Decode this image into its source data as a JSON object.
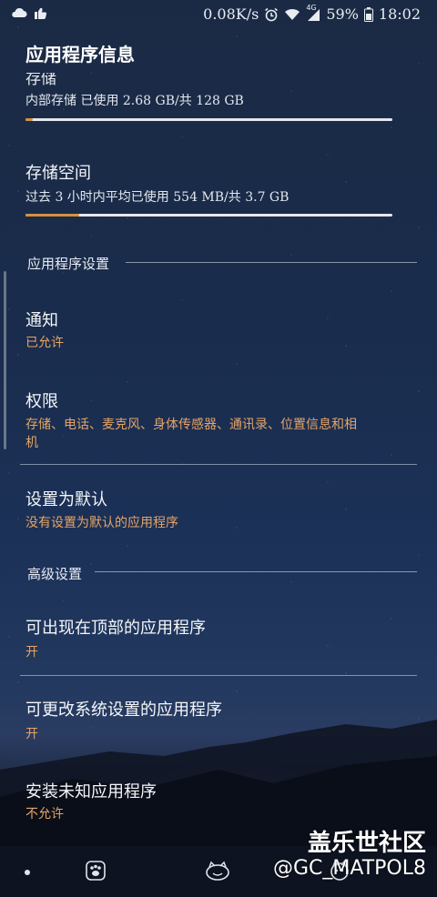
{
  "status_bar": {
    "speed": "0.08K/s",
    "battery_pct": "59%",
    "time": "18:02",
    "network": "4G",
    "icons": [
      "cloud-icon",
      "thumb-up-icon",
      "alarm-icon",
      "wifi-icon",
      "signal-icon",
      "battery-icon"
    ]
  },
  "header": {
    "title": "应用程序信息",
    "cut_off_item": "存储"
  },
  "storage_top": {
    "subtitle": "内部存储 已使用 2.68 GB/共 128 GB",
    "progress": 0.021
  },
  "storage_space": {
    "title": "存储空间",
    "subtitle": "过去 3 小时内平均已使用 554 MB/共 3.7 GB",
    "progress": 0.146
  },
  "sections": {
    "app_settings": "应用程序设置",
    "advanced": "高级设置"
  },
  "items": {
    "notifications": {
      "title": "通知",
      "value": "已允许"
    },
    "permissions": {
      "title": "权限",
      "value_line1": "存储、电话、麦克风、身体传感器、通讯录、位置信息和相",
      "value_line2": "机"
    },
    "default": {
      "title": "设置为默认",
      "value": "没有设置为默认的应用程序"
    },
    "on_top": {
      "title": "可出现在顶部的应用程序",
      "value": "开"
    },
    "system_settings": {
      "title": "可更改系统设置的应用程序",
      "value": "开"
    },
    "unknown_apps": {
      "title": "安装未知应用程序",
      "value": "不允许"
    }
  },
  "watermark": {
    "main": "盖乐世社区",
    "sub": "@GC_MATPOL8"
  },
  "colors": {
    "accent_orange": "#d6913c",
    "value_orange": "#e5a466"
  }
}
